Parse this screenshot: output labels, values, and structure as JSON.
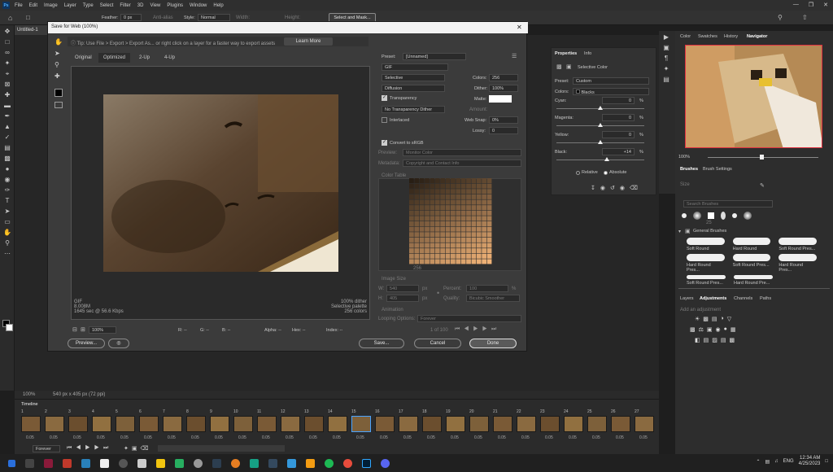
{
  "menubar": {
    "logo": "Ps",
    "items": [
      "File",
      "Edit",
      "Image",
      "Layer",
      "Type",
      "Select",
      "Filter",
      "3D",
      "View",
      "Plugins",
      "Window",
      "Help"
    ]
  },
  "optionsbar": {
    "feather_label": "Feather:",
    "feather_value": "0 px",
    "anti_alias": "Anti-alias",
    "style_label": "Style:",
    "style_value": "Normal",
    "width_label": "Width:",
    "height_label": "Height:",
    "select_mask": "Select and Mask..."
  },
  "document": {
    "tab": "Untitled-1",
    "zoom": "100%",
    "size_info": "540 px x 405 px (72 ppi)"
  },
  "dialog": {
    "title": "Save for Web (100%)",
    "tip": "Tip: Use File > Export > Export As... or right click on a layer for a faster way to export assets",
    "learn_more": "Learn More",
    "tabs": [
      "Original",
      "Optimized",
      "2-Up",
      "4-Up"
    ],
    "preset_label": "Preset:",
    "preset_value": "[Unnamed]",
    "format": "GIF",
    "reduction": "Selective",
    "dither_algo": "Diffusion",
    "colors_label": "Colors:",
    "colors_value": "256",
    "dither_label": "Dither:",
    "dither_value": "100%",
    "transparency": "Transparency",
    "matte_label": "Matte:",
    "no_transparency_dither": "No Transparency Dither",
    "amount_label": "Amount:",
    "interlaced": "Interlaced",
    "websnap_label": "Web Snap:",
    "websnap_value": "0%",
    "lossy_label": "Lossy:",
    "lossy_value": "0",
    "convert_srgb": "Convert to sRGB",
    "preview_label": "Preview:",
    "preview_value": "Monitor Color",
    "metadata_label": "Metadata:",
    "metadata_value": "Copyright and Contact Info",
    "color_table_label": "Color Table",
    "color_table_count": "256",
    "image_size_label": "Image Size",
    "w_label": "W:",
    "w_value": "540",
    "h_label": "H:",
    "h_value": "405",
    "px": "px",
    "percent_label": "Percent:",
    "percent_value": "100",
    "pct": "%",
    "quality_label": "Quality:",
    "quality_value": "Bicubic Smoother",
    "animation_label": "Animation",
    "looping_label": "Looping Options:",
    "looping_value": "Forever",
    "frame_counter": "1 of 100",
    "info_left": [
      "GIF",
      "8.008M",
      "1645 sec @ 56.6 Kbps"
    ],
    "info_right": [
      "100% dither",
      "Selective palette",
      "256 colors"
    ],
    "zoom": "100%",
    "readouts": [
      "R: --",
      "G: --",
      "B: --",
      "Alpha: --",
      "Hex: --",
      "Index: --"
    ],
    "preview_button": "Preview...",
    "save_button": "Save...",
    "cancel_button": "Cancel",
    "done_button": "Done"
  },
  "properties": {
    "tabs": [
      "Properties",
      "Info"
    ],
    "title": "Selective Color",
    "preset_label": "Preset:",
    "preset_value": "Custom",
    "colors_label": "Colors:",
    "colors_value": "Blacks",
    "sliders": [
      {
        "label": "Cyan:",
        "value": "0",
        "pct": "%",
        "level": 0.5
      },
      {
        "label": "Magenta:",
        "value": "0",
        "pct": "%",
        "level": 0.5
      },
      {
        "label": "Yellow:",
        "value": "0",
        "pct": "%",
        "level": 0.5
      },
      {
        "label": "Black:",
        "value": "+14",
        "pct": "%",
        "level": 0.57
      }
    ],
    "relative": "Relative",
    "absolute": "Absolute"
  },
  "navigator": {
    "tabs": [
      "Color",
      "Swatches",
      "History",
      "Navigator"
    ],
    "zoom": "100%"
  },
  "brushes": {
    "tabs": [
      "Brushes",
      "Brush Settings"
    ],
    "size_label": "Size",
    "search_placeholder": "Search Brushes",
    "group": "General Brushes",
    "sample_size": "25",
    "items": [
      "Soft Round",
      "Hard Round",
      "Soft Round Pres...",
      "Hard Round Pres...",
      "Soft Round Pres...",
      "Hard Round Pres...",
      "Soft Round Pres...",
      "Hard Round Pre..."
    ]
  },
  "adjustments": {
    "tabs": [
      "Layers",
      "Adjustments",
      "Channels",
      "Paths"
    ],
    "add_label": "Add an adjustment"
  },
  "timeline": {
    "title": "Timeline",
    "looping": "Forever",
    "frame_numbers": [
      "1",
      "2",
      "3",
      "4",
      "5",
      "6",
      "7",
      "8",
      "9",
      "10",
      "11",
      "12",
      "13",
      "14",
      "15",
      "16",
      "17",
      "18",
      "19",
      "20",
      "21",
      "22",
      "23",
      "24",
      "25",
      "26",
      "27"
    ],
    "durations": [
      "0.05",
      "0.05",
      "0.05",
      "0.05",
      "0.05",
      "0.05",
      "0.05",
      "0.05",
      "0.05",
      "0.05",
      "0.05",
      "0.05",
      "0.05",
      "0.05",
      "0.05",
      "0.05",
      "0.05",
      "0.05",
      "0.05",
      "0.05",
      "0.05",
      "0.05",
      "0.05",
      "0.05",
      "0.05",
      "0.05",
      "0.05"
    ]
  },
  "taskbar": {
    "lang": "ENG",
    "time": "12:34 AM",
    "date": "4/25/2023"
  },
  "colors": {
    "accent": "#1473e6",
    "dialog_bg": "#3b3b3b",
    "panel_bg": "#323232"
  }
}
